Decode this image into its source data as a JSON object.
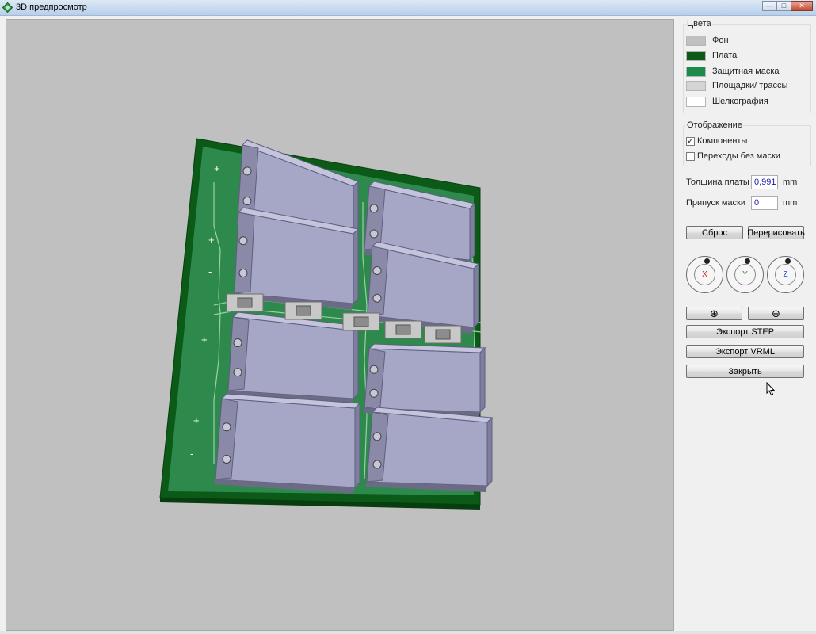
{
  "window": {
    "title": "3D предпросмотр",
    "minimize": "—",
    "maximize": "□",
    "close": "✕"
  },
  "colors": {
    "title": "Цвета",
    "items": [
      {
        "label": "Фон",
        "color": "#c0c0c0"
      },
      {
        "label": "Плата",
        "color": "#0b5a17"
      },
      {
        "label": "Защитная маска",
        "color": "#1c8a4a"
      },
      {
        "label": "Площадки/ трассы",
        "color": "#d4d4d4"
      },
      {
        "label": "Шелкография",
        "color": "#ffffff"
      }
    ]
  },
  "display": {
    "title": "Отображение",
    "components": {
      "label": "Компоненты",
      "checked": true,
      "mark": "✓"
    },
    "vias": {
      "label": "Переходы без маски",
      "checked": false,
      "mark": ""
    }
  },
  "board_thickness": {
    "label": "Толщина платы",
    "value": "0,991",
    "unit": "mm"
  },
  "mask_allowance": {
    "label": "Припуск маски",
    "value": "0",
    "unit": "mm"
  },
  "buttons": {
    "reset": "Сброс",
    "redraw": "Перерисовать",
    "zoom_in": "⊕",
    "zoom_out": "⊖",
    "export_step": "Экспорт STEP",
    "export_vrml": "Экспорт VRML",
    "close": "Закрыть"
  },
  "rotation": {
    "x": "X",
    "y": "Y",
    "z": "Z"
  },
  "board_labels": {
    "plus": "+",
    "minus": "-"
  }
}
